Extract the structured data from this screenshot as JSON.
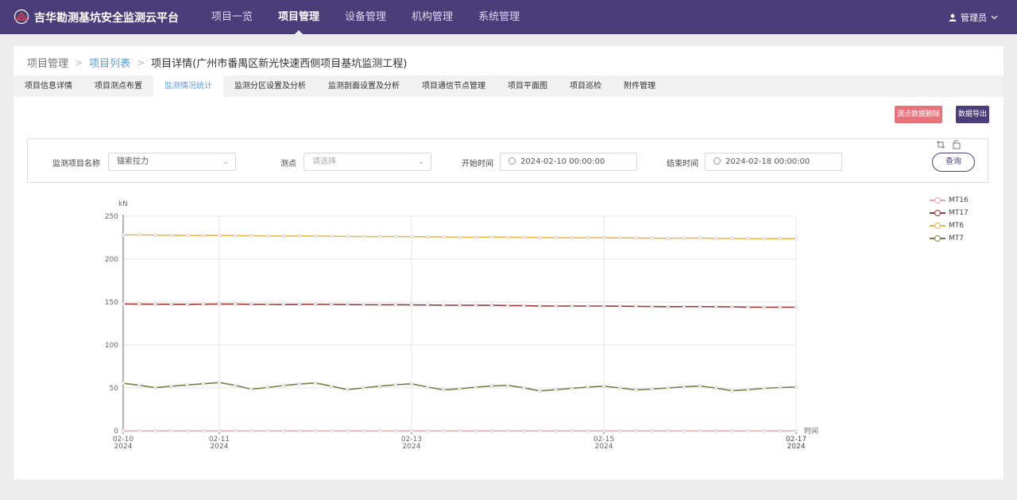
{
  "header": {
    "brand": "吉华勘测基坑安全监测云平台",
    "nav": [
      {
        "label": "项目一览",
        "active": false
      },
      {
        "label": "项目管理",
        "active": true
      },
      {
        "label": "设备管理",
        "active": false
      },
      {
        "label": "机构管理",
        "active": false
      },
      {
        "label": "系统管理",
        "active": false
      }
    ],
    "user": "管理员"
  },
  "breadcrumb": {
    "root": "项目管理",
    "list": "项目列表",
    "current": "项目详情(广州市番禺区新光快速西侧项目基坑监测工程)"
  },
  "tabs": [
    {
      "label": "项目信息详情",
      "active": false
    },
    {
      "label": "项目测点布置",
      "active": false
    },
    {
      "label": "监测情况统计",
      "active": true
    },
    {
      "label": "监测分区设置及分析",
      "active": false
    },
    {
      "label": "监测剖面设置及分析",
      "active": false
    },
    {
      "label": "项目通信节点管理",
      "active": false
    },
    {
      "label": "项目平面图",
      "active": false
    },
    {
      "label": "项目巡检",
      "active": false
    },
    {
      "label": "附件管理",
      "active": false
    }
  ],
  "actions": {
    "delete_label": "测点数据删除",
    "export_label": "数据导出"
  },
  "filter": {
    "project_label": "监测项目名称",
    "project_value": "锚索拉力",
    "point_label": "测点",
    "point_placeholder": "请选择",
    "start_label": "开始时间",
    "start_value": "2024-02-10 00:00:00",
    "end_label": "结束时间",
    "end_value": "2024-02-18 00:00:00",
    "query_label": "查询"
  },
  "chart_data": {
    "type": "line",
    "ylabel": "kN",
    "xlabel": "时间",
    "ylim": [
      0,
      250
    ],
    "yticks": [
      0,
      50,
      100,
      150,
      200,
      250
    ],
    "xlim": [
      "2024-02-10",
      "2024-02-17"
    ],
    "xticks": [
      {
        "date": "2024-02-10",
        "line1": "02-10",
        "line2": "2024"
      },
      {
        "date": "2024-02-11",
        "line1": "02-11",
        "line2": "2024"
      },
      {
        "date": "2024-02-13",
        "line1": "02-13",
        "line2": "2024"
      },
      {
        "date": "2024-02-15",
        "line1": "02-15",
        "line2": "2024"
      },
      {
        "date": "2024-02-17",
        "line1": "02-17",
        "line2": "2024"
      },
      {
        "date": "2024-02-17",
        "line1": "02-17",
        "line2": "2024"
      }
    ],
    "grid": true,
    "legend": "right",
    "x": [
      "2024-02-10 00:00",
      "2024-02-10 04:00",
      "2024-02-10 08:00",
      "2024-02-10 12:00",
      "2024-02-10 16:00",
      "2024-02-10 20:00",
      "2024-02-11 00:00",
      "2024-02-11 04:00",
      "2024-02-11 08:00",
      "2024-02-11 12:00",
      "2024-02-11 16:00",
      "2024-02-11 20:00",
      "2024-02-12 00:00",
      "2024-02-12 04:00",
      "2024-02-12 08:00",
      "2024-02-12 12:00",
      "2024-02-12 16:00",
      "2024-02-12 20:00",
      "2024-02-13 00:00",
      "2024-02-13 04:00",
      "2024-02-13 08:00",
      "2024-02-13 12:00",
      "2024-02-13 16:00",
      "2024-02-13 20:00",
      "2024-02-14 00:00",
      "2024-02-14 04:00",
      "2024-02-14 08:00",
      "2024-02-14 12:00",
      "2024-02-14 16:00",
      "2024-02-14 20:00",
      "2024-02-15 00:00",
      "2024-02-15 04:00",
      "2024-02-15 08:00",
      "2024-02-15 12:00",
      "2024-02-15 16:00",
      "2024-02-15 20:00",
      "2024-02-16 00:00",
      "2024-02-16 04:00",
      "2024-02-16 08:00",
      "2024-02-16 12:00",
      "2024-02-16 16:00",
      "2024-02-16 20:00",
      "2024-02-17 00:00"
    ],
    "series": [
      {
        "name": "MT16",
        "color": "#f0a3a9",
        "values": [
          0,
          0,
          0,
          0,
          0,
          0,
          0,
          0,
          0,
          0,
          0,
          0,
          0,
          0,
          0,
          0,
          0,
          0,
          0,
          0,
          0,
          0,
          0,
          0,
          0,
          0,
          0,
          0,
          0,
          0,
          0,
          0,
          0,
          0,
          0,
          0,
          0,
          0,
          0,
          0,
          0,
          0,
          0
        ]
      },
      {
        "name": "MT17",
        "color": "#9c3a3a",
        "values": [
          147.8,
          147.6,
          147.5,
          147.4,
          147.3,
          147.5,
          147.8,
          147.6,
          147.4,
          147.2,
          147.0,
          147.3,
          147.4,
          147.2,
          147.0,
          146.9,
          146.8,
          146.9,
          146.7,
          146.6,
          146.4,
          146.3,
          146.2,
          146.3,
          145.9,
          145.7,
          145.5,
          145.4,
          145.3,
          145.4,
          145.4,
          145.2,
          145.0,
          144.8,
          144.6,
          144.7,
          144.7,
          144.6,
          144.4,
          144.2,
          144.0,
          144.1,
          144.0
        ]
      },
      {
        "name": "MT6",
        "color": "#e8b84f",
        "values": [
          228.3,
          228.2,
          228.1,
          227.7,
          227.5,
          227.6,
          227.6,
          227.4,
          227.2,
          227.0,
          226.9,
          227.0,
          226.9,
          226.7,
          226.5,
          226.3,
          226.3,
          226.4,
          226.2,
          226.0,
          225.8,
          225.6,
          225.5,
          225.7,
          225.6,
          225.4,
          225.2,
          225.0,
          224.9,
          225.0,
          225.0,
          224.8,
          224.6,
          224.4,
          224.3,
          224.5,
          224.4,
          224.2,
          224.1,
          223.9,
          223.8,
          223.9,
          223.8
        ]
      },
      {
        "name": "MT7",
        "color": "#7a7d45",
        "values": [
          55.5,
          53.1,
          50.3,
          52.0,
          53.4,
          54.8,
          56.3,
          53.0,
          48.5,
          50.5,
          52.8,
          54.5,
          55.7,
          52.0,
          48.0,
          50.0,
          52.0,
          53.6,
          54.8,
          51.0,
          47.8,
          49.0,
          50.8,
          52.2,
          53.0,
          50.2,
          46.5,
          48.0,
          49.5,
          51.0,
          52.0,
          50.0,
          47.8,
          48.6,
          50.0,
          51.3,
          52.2,
          49.8,
          46.7,
          48.0,
          49.5,
          50.5,
          51.0
        ]
      }
    ]
  }
}
